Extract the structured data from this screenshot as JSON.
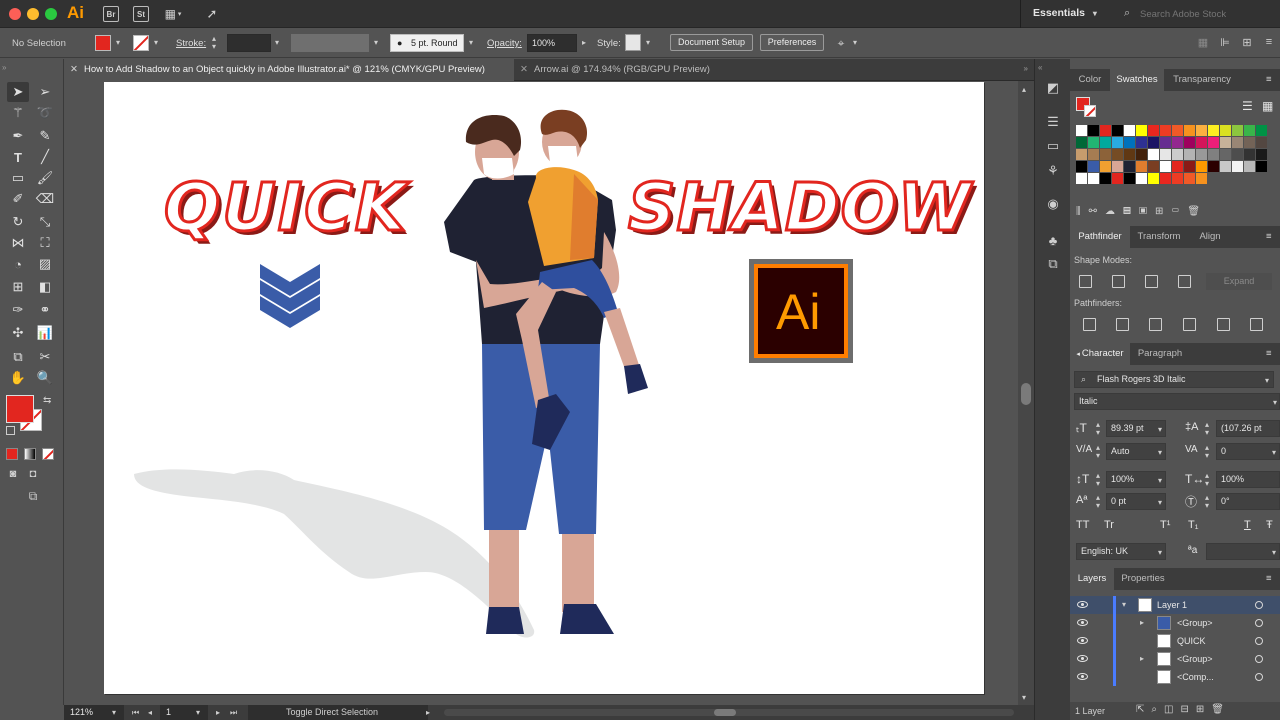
{
  "app": {
    "logo": "Ai",
    "bridge": "Br",
    "stock": "St",
    "workspace": "Essentials",
    "search_placeholder": "Search Adobe Stock"
  },
  "colors": {
    "accent": "#e2261f",
    "ai_orange": "#ff9a00",
    "panel_bg": "#535353",
    "dark_bg": "#323232",
    "shirt_navy": "#1f2233",
    "jeans_blue": "#3a5ca8",
    "shirt_orange": "#f0a030",
    "skin": "#d8a696"
  },
  "control": {
    "selection": "No Selection",
    "stroke_label": "Stroke:",
    "brush": "5 pt. Round",
    "opacity_label": "Opacity:",
    "opacity_value": "100%",
    "style_label": "Style:",
    "doc_setup": "Document Setup",
    "preferences": "Preferences"
  },
  "tabs": [
    {
      "label": "How to Add Shadow to an Object quickly in Adobe Illustrator.ai* @ 121% (CMYK/GPU Preview)",
      "active": true
    },
    {
      "label": "Arrow.ai @ 174.94% (RGB/GPU Preview)",
      "active": false
    }
  ],
  "artwork": {
    "word_left": "QUICK",
    "word_right": "SHADOW",
    "badge": "Ai"
  },
  "status": {
    "zoom": "121%",
    "artboard": "1",
    "tool_hint": "Toggle Direct Selection"
  },
  "panels": {
    "swatches_tabs": [
      "Color",
      "Swatches",
      "Transparency"
    ],
    "pathfinder_tabs": [
      "Pathfinder",
      "Transform",
      "Align"
    ],
    "shape_modes": "Shape Modes:",
    "expand": "Expand",
    "pathfinders": "Pathfinders:",
    "character_tabs": [
      "Character",
      "Paragraph"
    ],
    "font": "Flash Rogers 3D Italic",
    "style": "Italic",
    "font_size": "89.39 pt",
    "leading": "(107.26 pt",
    "kerning": "Auto",
    "tracking": "0",
    "vscale": "100%",
    "hscale": "100%",
    "baseline": "0 pt",
    "rotation": "0°",
    "language": "English: UK",
    "type_buttons": [
      "TT",
      "Tr",
      "T¹",
      "T₁",
      "T",
      "Ŧ"
    ],
    "aa_label": "ªa"
  },
  "layers": {
    "tabs": [
      "Layers",
      "Properties"
    ],
    "rows": [
      {
        "name": "Layer 1",
        "level": 0,
        "expanded": true
      },
      {
        "name": "<Group>",
        "level": 1,
        "expanded": false
      },
      {
        "name": "QUICK",
        "level": 1,
        "expanded": false
      },
      {
        "name": "<Group>",
        "level": 1,
        "expanded": false
      },
      {
        "name": "<Comp...",
        "level": 1,
        "expanded": false
      }
    ],
    "count": "1 Layer"
  }
}
